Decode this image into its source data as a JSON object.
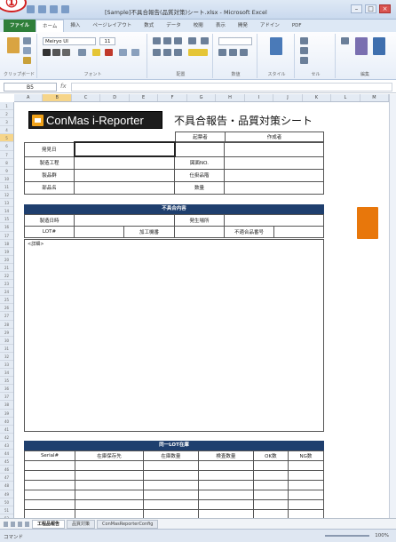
{
  "window": {
    "title": "[Sample]不具合報告(品質対策)シート.xlsx - Microsoft Excel",
    "badge": "①"
  },
  "ribbon": {
    "tabs": [
      "ファイル",
      "ホーム",
      "挿入",
      "ページレイアウト",
      "数式",
      "データ",
      "校閲",
      "表示",
      "開発",
      "アドイン",
      "PDF"
    ],
    "active_tab": "ホーム",
    "groups": [
      "クリップボード",
      "フォント",
      "配置",
      "数値",
      "スタイル",
      "セル",
      "編集"
    ],
    "font_name": "Meiryo UI",
    "font_size": "11"
  },
  "formula_bar": {
    "name_box": "B5",
    "fx": "fx",
    "value": ""
  },
  "columns": [
    "A",
    "B",
    "C",
    "D",
    "E",
    "F",
    "G",
    "H",
    "I",
    "J",
    "K",
    "L",
    "M"
  ],
  "sheet": {
    "logo_text": "ConMas i-Reporter",
    "doc_title": "不具合報告・品質対策シート",
    "header_right": {
      "col1": "起票者",
      "col2": "作成者"
    },
    "info_left": [
      "発見日",
      "製造工程",
      "製品群",
      "部品名"
    ],
    "info_right": [
      "図面NO.",
      "仕掛品階",
      "数量"
    ],
    "section1_title": "不具合内容",
    "s1_row1": [
      "製造日時",
      "",
      "発生場所",
      ""
    ],
    "s1_row2": [
      "LOT#",
      "",
      "加工機番",
      "",
      "不適合品番号",
      ""
    ],
    "detail_label": "<詳細>",
    "section2_title": "同一LOT在庫",
    "lot_headers": [
      "Serial#",
      "在庫保存先",
      "在庫数量",
      "検査数量",
      "OK数",
      "NG数"
    ]
  },
  "sheet_tabs": [
    "工程品報告",
    "品質対策",
    "ConMasReporterConfig"
  ],
  "status": {
    "ready": "コマンド",
    "zoom": "100%"
  }
}
